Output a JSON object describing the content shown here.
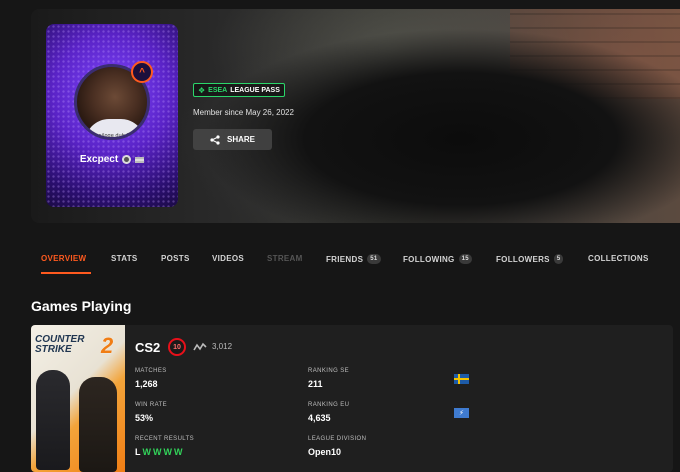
{
  "profile": {
    "username": "Excpect",
    "level_badge": "^",
    "avatar_shirt_text": "emeniloge dub bocasi",
    "league_pass": {
      "esea": "ESEA",
      "rest": "LEAGUE PASS"
    },
    "member_since": "Member since May 26, 2022",
    "share_label": "SHARE"
  },
  "tabs": [
    {
      "label": "OVERVIEW",
      "state": "active"
    },
    {
      "label": "STATS"
    },
    {
      "label": "POSTS"
    },
    {
      "label": "VIDEOS"
    },
    {
      "label": "STREAM",
      "state": "disabled"
    },
    {
      "label": "FRIENDS",
      "count": "51"
    },
    {
      "label": "FOLLOWING",
      "count": "15"
    },
    {
      "label": "FOLLOWERS",
      "count": "5"
    },
    {
      "label": "COLLECTIONS"
    }
  ],
  "games_section": {
    "title": "Games Playing",
    "game": {
      "cover_title": "COUNTER STRIKE",
      "cover_number": "2",
      "name": "CS2",
      "skill_level": "10",
      "elo": "3,012",
      "stats": {
        "matches_label": "MATCHES",
        "matches": "1,268",
        "winrate_label": "WIN RATE",
        "winrate": "53%",
        "results_label": "RECENT RESULTS",
        "results": [
          "L",
          "W",
          "W",
          "W",
          "W"
        ],
        "ranking_se_label": "RANKING SE",
        "ranking_se": "211",
        "ranking_eu_label": "RANKING EU",
        "ranking_eu": "4,635",
        "league_label": "LEAGUE DIVISION",
        "league": "Open10"
      }
    }
  },
  "colors": {
    "accent": "#ff5a1f",
    "win": "#32d35a",
    "league_green": "#2bd66a",
    "profile_purple": "#5a23c7"
  }
}
